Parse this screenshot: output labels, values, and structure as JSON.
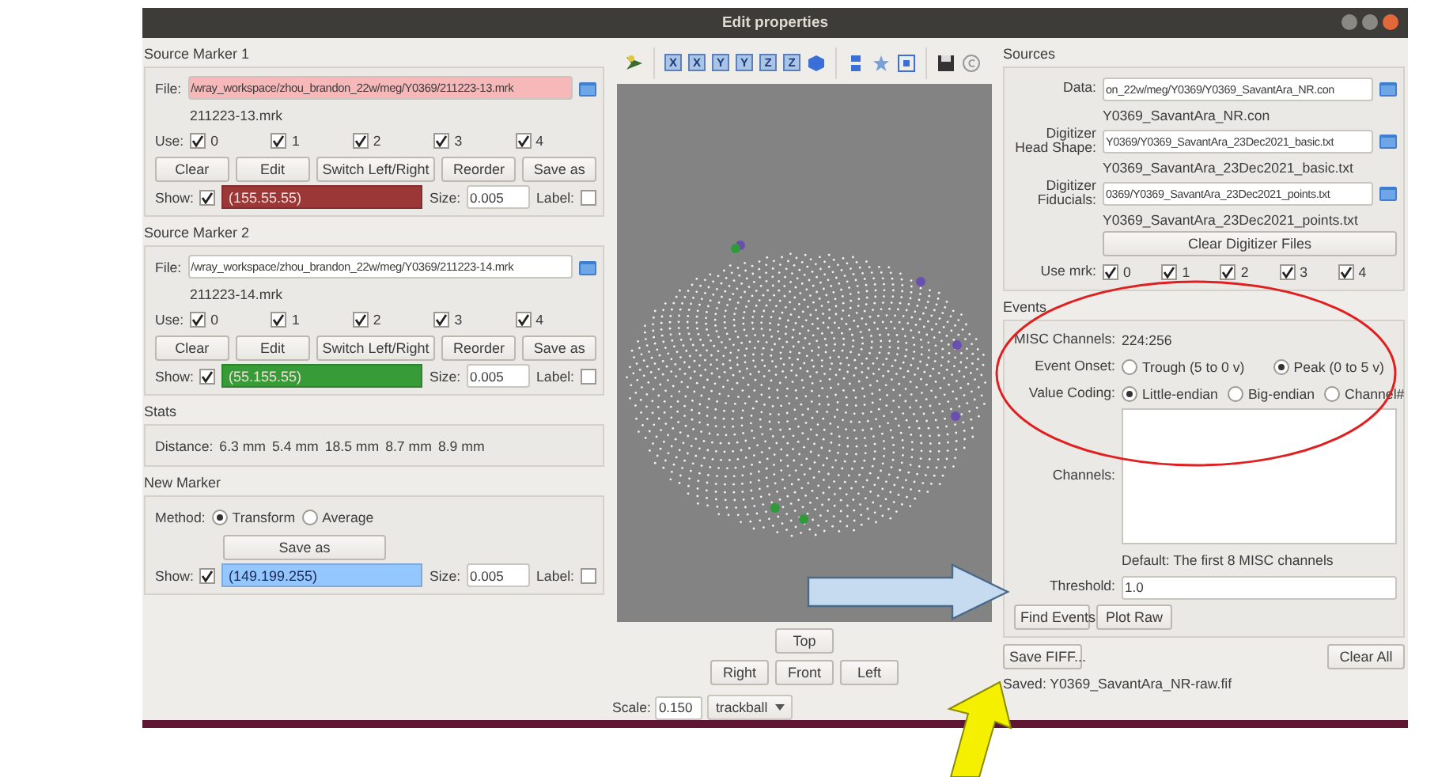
{
  "window": {
    "title": "Edit properties"
  },
  "source_markers": [
    {
      "title": "Source Marker 1",
      "file_label": "File:",
      "file_path": "/wray_workspace/zhou_brandon_22w/meg/Y0369/211223-13.mrk",
      "highlighted": true,
      "file_name": "211223-13.mrk",
      "use_label": "Use:",
      "use": [
        {
          "label": "0",
          "checked": true
        },
        {
          "label": "1",
          "checked": true
        },
        {
          "label": "2",
          "checked": true
        },
        {
          "label": "3",
          "checked": true
        },
        {
          "label": "4",
          "checked": true
        }
      ],
      "buttons": [
        "Clear",
        "Edit",
        "Switch Left/Right",
        "Reorder",
        "Save as"
      ],
      "show_label": "Show:",
      "show": true,
      "color_text": "(155.55.55)",
      "color": "#9b3737",
      "size_label": "Size:",
      "size": "0.005",
      "label_label": "Label:",
      "label_checked": false
    },
    {
      "title": "Source Marker 2",
      "file_label": "File:",
      "file_path": "/wray_workspace/zhou_brandon_22w/meg/Y0369/211223-14.mrk",
      "highlighted": false,
      "file_name": "211223-14.mrk",
      "use_label": "Use:",
      "use": [
        {
          "label": "0",
          "checked": true
        },
        {
          "label": "1",
          "checked": true
        },
        {
          "label": "2",
          "checked": true
        },
        {
          "label": "3",
          "checked": true
        },
        {
          "label": "4",
          "checked": true
        }
      ],
      "buttons": [
        "Clear",
        "Edit",
        "Switch Left/Right",
        "Reorder",
        "Save as"
      ],
      "show_label": "Show:",
      "show": true,
      "color_text": "(55.155.55)",
      "color": "#379b37",
      "size_label": "Size:",
      "size": "0.005",
      "label_label": "Label:",
      "label_checked": false
    }
  ],
  "stats": {
    "title": "Stats",
    "label": "Distance:",
    "values": [
      "6.3 mm",
      "5.4 mm",
      "18.5 mm",
      "8.7 mm",
      "8.9 mm"
    ]
  },
  "new_marker": {
    "title": "New Marker",
    "method_label": "Method:",
    "methods": [
      {
        "label": "Transform",
        "selected": true
      },
      {
        "label": "Average",
        "selected": false
      }
    ],
    "save_button": "Save as",
    "show_label": "Show:",
    "show": true,
    "color_text": "(149.199.255)",
    "color": "#95c7ff",
    "size_label": "Size:",
    "size": "0.005",
    "label_label": "Label:",
    "label_checked": false
  },
  "view": {
    "axis_buttons": [
      "X",
      "X",
      "Y",
      "Y",
      "Z",
      "Z"
    ],
    "buttons": [
      "Top",
      "Right",
      "Front",
      "Left"
    ],
    "scale_label": "Scale:",
    "scale": "0.150",
    "mode": "trackball"
  },
  "sources": {
    "title": "Sources",
    "files": [
      {
        "label": "Data:",
        "path": "on_22w/meg/Y0369/Y0369_SavantAra_NR.con",
        "name": "Y0369_SavantAra_NR.con"
      },
      {
        "label": "Digitizer\nHead Shape:",
        "path": "Y0369/Y0369_SavantAra_23Dec2021_basic.txt",
        "name": "Y0369_SavantAra_23Dec2021_basic.txt"
      },
      {
        "label": "Digitizer\nFiducials:",
        "path": "0369/Y0369_SavantAra_23Dec2021_points.txt",
        "name": "Y0369_SavantAra_23Dec2021_points.txt"
      }
    ],
    "clear_button": "Clear Digitizer Files",
    "use_label": "Use mrk:",
    "use": [
      {
        "label": "0",
        "checked": true
      },
      {
        "label": "1",
        "checked": true
      },
      {
        "label": "2",
        "checked": true
      },
      {
        "label": "3",
        "checked": true
      },
      {
        "label": "4",
        "checked": true
      }
    ]
  },
  "events": {
    "title": "Events",
    "misc_label": "MISC Channels:",
    "misc_value": "224:256",
    "onset_label": "Event Onset:",
    "onset": [
      {
        "label": "Trough (5 to 0 v)",
        "selected": false
      },
      {
        "label": "Peak (0 to 5 v)",
        "selected": true
      }
    ],
    "coding_label": "Value Coding:",
    "coding": [
      {
        "label": "Little-endian",
        "selected": true
      },
      {
        "label": "Big-endian",
        "selected": false
      },
      {
        "label": "Channel#",
        "selected": false
      }
    ],
    "channels_label": "Channels:",
    "default_text": "Default:  The first 8 MISC channels",
    "threshold_label": "Threshold:",
    "threshold": "1.0",
    "buttons": [
      "Find Events",
      "Plot Raw"
    ]
  },
  "footer": {
    "save_button": "Save FIFF...",
    "clear_button": "Clear All",
    "saved_text": "Saved: Y0369_SavantAra_NR-raw.fif"
  }
}
